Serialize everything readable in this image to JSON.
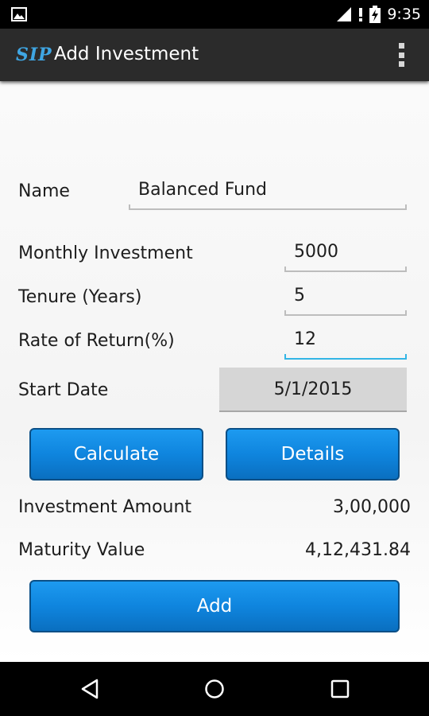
{
  "status_bar": {
    "time": "9:35",
    "icons": [
      "image-icon",
      "signal-icon",
      "battery-charging-icon"
    ]
  },
  "action_bar": {
    "logo": "SIP",
    "title": "Add Investment",
    "overflow_icon": "overflow-menu-icon"
  },
  "form": {
    "name": {
      "label": "Name",
      "value": "Balanced Fund"
    },
    "monthly_investment": {
      "label": "Monthly Investment",
      "value": "5000"
    },
    "tenure": {
      "label": "Tenure (Years)",
      "value": "5"
    },
    "rate_of_return": {
      "label": "Rate of Return(%)",
      "value": "12"
    },
    "start_date": {
      "label": "Start Date",
      "value": "5/1/2015"
    }
  },
  "buttons": {
    "calculate": "Calculate",
    "details": "Details",
    "add": "Add"
  },
  "results": {
    "investment_amount": {
      "label": "Investment Amount",
      "value": "3,00,000"
    },
    "maturity_value": {
      "label": "Maturity Value",
      "value": "4,12,431.84"
    }
  },
  "colors": {
    "accent": "#33b5e5",
    "button": "#0f85de",
    "action_bar": "#2b2b2b",
    "logo": "#3fa6e3"
  },
  "nav_bar": {
    "icons": [
      "back-icon",
      "home-icon",
      "recents-icon"
    ]
  }
}
